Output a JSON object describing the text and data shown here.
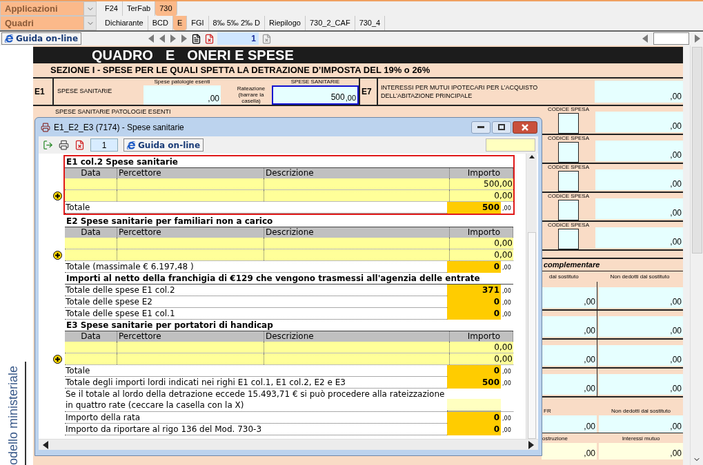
{
  "menus": [
    {
      "label": "Applicazioni",
      "tabs": [
        {
          "label": "F24",
          "selected": false
        },
        {
          "label": "TerFab",
          "selected": false
        },
        {
          "label": "730",
          "selected": true
        }
      ]
    },
    {
      "label": "Quadri",
      "tabs": [
        {
          "label": "Dichiarante",
          "selected": false
        },
        {
          "label": "BCD",
          "selected": false
        },
        {
          "label": "E",
          "selected": true
        },
        {
          "label": "FGI",
          "selected": false
        },
        {
          "label": "8‰ 5‰ 2‰ D",
          "selected": false
        },
        {
          "label": "Riepilogo",
          "selected": false
        },
        {
          "label": "730_2_CAF",
          "selected": false
        },
        {
          "label": "730_4",
          "selected": false
        }
      ]
    }
  ],
  "toolbar": {
    "help_button": "Guida on-line",
    "page": "1"
  },
  "side_label": "odello ministeriale",
  "form": {
    "title": "QUADRO",
    "code": "E",
    "name": "ONERI E SPESE",
    "section": "SEZIONE I -  SPESE PER LE QUALI SPETTA LA DETRAZIONE D’IMPOSTA DEL 19% o 26%",
    "e1": {
      "code": "E1",
      "label": "SPESE SANITARIE",
      "field_1_caption": "Spese patologie esenti",
      "field_1_value": ",00",
      "rateazione": "Rateazione (barrare la casella)",
      "field_2_caption": "SPESE SANITARIE",
      "field_2_value": "500",
      "field_2_decimals": ",00"
    },
    "e2_label": "SPESE SANITARIE PATOLOGIE ESENTI",
    "e7": {
      "code": "E7",
      "label": "INTERESSI PER MUTUI IPOTECARI PER L’ACQUISTO DELL’ABITAZIONE PRINCIPALE",
      "value": ",00"
    },
    "expense_rows": [
      {
        "caption": "CODICE SPESA",
        "value": ",00"
      },
      {
        "caption": "CODICE SPESA",
        "value": ",00"
      },
      {
        "caption": "CODICE SPESA",
        "value": ",00"
      },
      {
        "caption": "CODICE SPESA",
        "value": ",00"
      },
      {
        "caption": "CODICE SPESA",
        "value": ",00"
      }
    ],
    "complementare": {
      "title": "complementare",
      "col_1": "dal sostituto",
      "col_2": "Non dedotti dal sostituto",
      "rows": [
        {
          "value_1": ",00",
          "value_2": ",00"
        },
        {
          "value_1": ",00",
          "value_2": ",00"
        },
        {
          "value_1": ",00",
          "value_2": ",00"
        },
        {
          "value_1": ",00",
          "value_2": ",00"
        }
      ]
    },
    "tfr": {
      "col_1": "FR",
      "col_2": "Non dedotti dal sostituto",
      "value_1": ",00",
      "value_2": ",00"
    },
    "mutuo": {
      "col_1": "ostruzione",
      "col_2": "Interessi mutuo",
      "value_1": ",00",
      "value_2": ",00"
    }
  },
  "dialog": {
    "title": "E1_E2_E3 (7174) - Spese sanitarie",
    "page": "1",
    "help_button": "Guida on-line",
    "sections": [
      {
        "highlighted": true,
        "rows": [
          {
            "kind": "heading",
            "text": "E1 col.2 Spese sanitarie"
          },
          {
            "kind": "columns",
            "cells": [
              "Data",
              "Percettore",
              "Descrizione",
              "Importo"
            ]
          },
          {
            "kind": "entry",
            "amount": "500,00",
            "add_button": false
          },
          {
            "kind": "entry",
            "amount": "0,00",
            "add_button": true
          },
          {
            "kind": "total",
            "label": "Totale",
            "value": "500",
            "decimals": ",00"
          }
        ]
      },
      {
        "highlighted": false,
        "rows": [
          {
            "kind": "heading",
            "text": "E2 Spese sanitarie per familiari non a carico"
          },
          {
            "kind": "columns",
            "cells": [
              "Data",
              "Percettore",
              "Descrizione",
              "Importo"
            ]
          },
          {
            "kind": "entry",
            "amount": "0,00",
            "add_button": false
          },
          {
            "kind": "entry",
            "amount": "0,00",
            "add_button": true
          },
          {
            "kind": "total",
            "label": "Totale (massimale € 6.197,48 )",
            "value": "0",
            "decimals": ",00"
          },
          {
            "kind": "heading",
            "text": "Importi al netto della franchigia di €129 che vengono trasmessi all'agenzia delle entrate"
          },
          {
            "kind": "total",
            "label": "Totale delle spese E1 col.2",
            "value": "371",
            "decimals": ",00"
          },
          {
            "kind": "total",
            "label": "Totale delle spese E2",
            "value": "0",
            "decimals": ",00"
          },
          {
            "kind": "total",
            "label": "Totale delle spese E1 col.1",
            "value": "0",
            "decimals": ",00"
          },
          {
            "kind": "heading",
            "text": "E3 Spese sanitarie per portatori di handicap"
          },
          {
            "kind": "columns",
            "cells": [
              "Data",
              "Percettore",
              "Descrizione",
              "Importo"
            ]
          },
          {
            "kind": "entry",
            "amount": "0,00",
            "add_button": false
          },
          {
            "kind": "entry",
            "amount": "0,00",
            "add_button": true
          },
          {
            "kind": "total",
            "label": "Totale",
            "value": "0",
            "decimals": ",00"
          },
          {
            "kind": "total",
            "label": "Totale degli importi lordi indicati nei righi E1 col.1, E1 col.2, E2 e E3",
            "value": "500",
            "decimals": ",00"
          },
          {
            "kind": "note",
            "text": "Se il totale al lordo della detrazione eccede 15.493,71 € si può procedere alla rateizzazione in quattro rate (ceccare la casella con la X)"
          },
          {
            "kind": "total",
            "label": "Importo della rata",
            "value": "0",
            "decimals": ",00"
          },
          {
            "kind": "total",
            "label": "Importo da riportare al rigo 136 del Mod. 730-3",
            "value": "0",
            "decimals": ",00"
          }
        ]
      }
    ]
  }
}
